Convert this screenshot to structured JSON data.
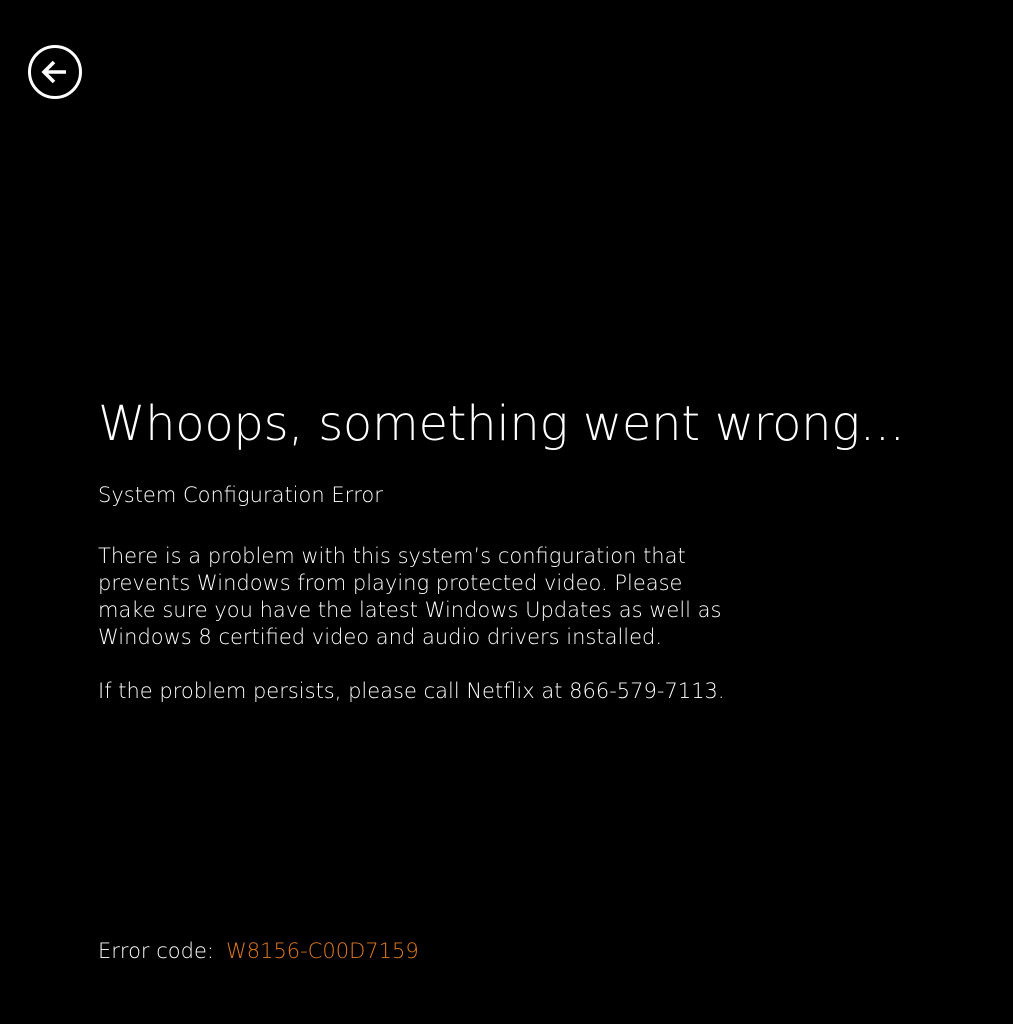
{
  "back_button": {
    "icon": "back-arrow-icon"
  },
  "error": {
    "title": "Whoops, something went wrong...",
    "subtitle": "System Configuration Error",
    "message_lines": [
      "There is a problem with this system’s configuration that",
      "prevents Windows from playing protected video.  Please",
      "make sure you have the latest Windows Updates as well as",
      "Windows 8 certified video and audio drivers installed."
    ],
    "persist_message": "If the problem persists, please call Netflix at 866-579-7113.",
    "code_label": "Error code:",
    "code_value": "W8156-C00D7159"
  },
  "colors": {
    "background": "#000000",
    "text": "#ffffff",
    "error_code": "#e07a1f"
  }
}
